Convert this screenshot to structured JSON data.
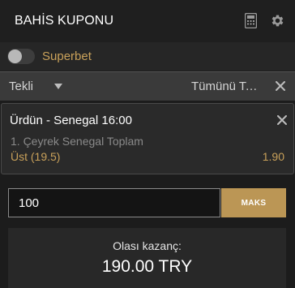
{
  "header": {
    "title": "BAHİS KUPONU",
    "icons": [
      "calculator-icon",
      "gear-icon"
    ]
  },
  "superbet": {
    "label": "Superbet",
    "enabled": false
  },
  "bet_type": {
    "selected": "Tekli",
    "clear_all_label": "Tümünü Temizle"
  },
  "bet": {
    "match": "Ürdün - Senegal 16:00",
    "market": "1. Çeyrek Senegal Toplam",
    "selection": "Üst (19.5)",
    "odds": "1.90"
  },
  "stake": {
    "value": "100",
    "max_label": "MAKS"
  },
  "payout": {
    "label": "Olası kazanç:",
    "value": "190.00 TRY"
  },
  "colors": {
    "accent": "#c9a15a",
    "button": "#bb9655",
    "background": "#1c1c1c"
  }
}
